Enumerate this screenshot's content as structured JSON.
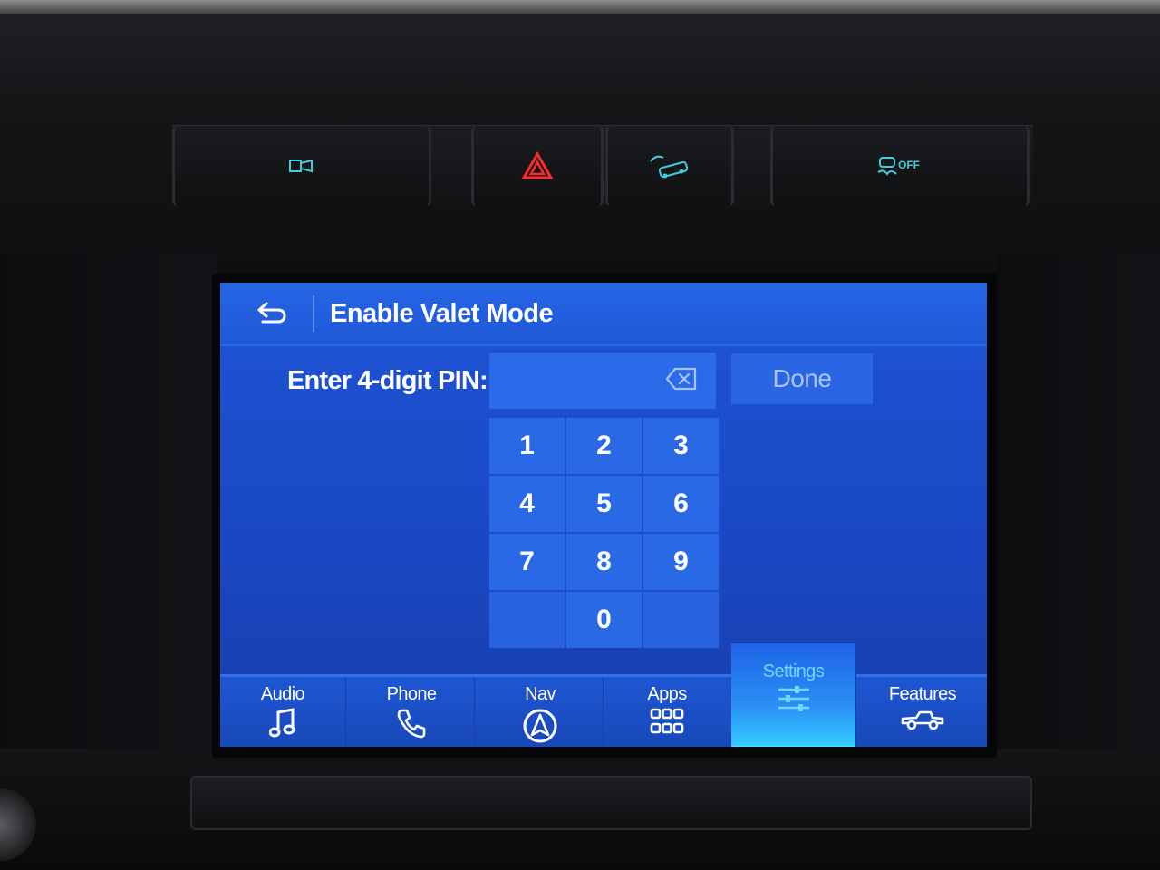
{
  "header": {
    "back_icon": "back-arrow-icon",
    "title": "Enable Valet Mode"
  },
  "pin_entry": {
    "label": "Enter 4-digit PIN:",
    "value": "",
    "clear_icon": "backspace-icon",
    "done_label": "Done"
  },
  "keypad": {
    "keys": [
      "1",
      "2",
      "3",
      "4",
      "5",
      "6",
      "7",
      "8",
      "9",
      "",
      "0",
      ""
    ]
  },
  "nav": {
    "items": [
      {
        "label": "Audio",
        "icon": "music-note-icon"
      },
      {
        "label": "Phone",
        "icon": "phone-icon"
      },
      {
        "label": "Nav",
        "icon": "navigation-arrow-icon"
      },
      {
        "label": "Apps",
        "icon": "apps-grid-icon"
      },
      {
        "label": "Settings",
        "icon": "sliders-icon",
        "active": true
      },
      {
        "label": "Features",
        "icon": "truck-icon"
      }
    ]
  },
  "physical_switches": [
    {
      "icon": "camera-icon",
      "color": "#3fd0e0"
    },
    {
      "icon": "hazard-icon",
      "color": "#ff2a2a"
    },
    {
      "icon": "park-assist-icon",
      "color": "#3fd0e0"
    },
    {
      "icon": "traction-control-off-icon",
      "color": "#3fd0e0",
      "text": "OFF"
    }
  ],
  "colors": {
    "screen_blue": "#1e55d6",
    "key_blue": "#2a69e5",
    "active_accent": "#45e2ff",
    "hazard_red": "#ff2a2a"
  }
}
